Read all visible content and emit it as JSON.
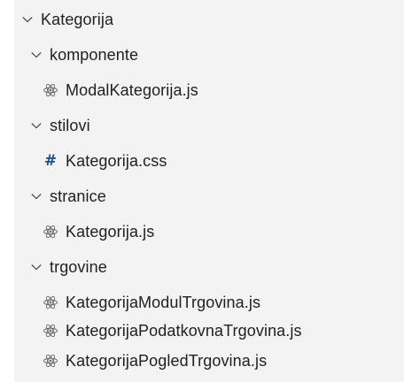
{
  "explorer": {
    "root": {
      "label": "Kategorija",
      "expanded": true
    },
    "folders": [
      {
        "label": "komponente",
        "expanded": true,
        "files": [
          {
            "label": "ModalKategorija.js",
            "icon": "react-icon"
          }
        ]
      },
      {
        "label": "stilovi",
        "expanded": true,
        "files": [
          {
            "label": "Kategorija.css",
            "icon": "css-hash-icon"
          }
        ]
      },
      {
        "label": "stranice",
        "expanded": true,
        "files": [
          {
            "label": "Kategorija.js",
            "icon": "react-icon"
          }
        ]
      },
      {
        "label": "trgovine",
        "expanded": true,
        "files": [
          {
            "label": "KategorijaModulTrgovina.js",
            "icon": "react-icon"
          },
          {
            "label": "KategorijaPodatkovnaTrgovina.js",
            "icon": "react-icon"
          },
          {
            "label": "KategorijaPogledTrgovina.js",
            "icon": "react-icon"
          }
        ]
      }
    ],
    "colors": {
      "background": "#f3f3f3",
      "text": "#1f1f1f",
      "react_icon": "#6b6b6b",
      "css_icon": "#1d4f8c"
    }
  }
}
